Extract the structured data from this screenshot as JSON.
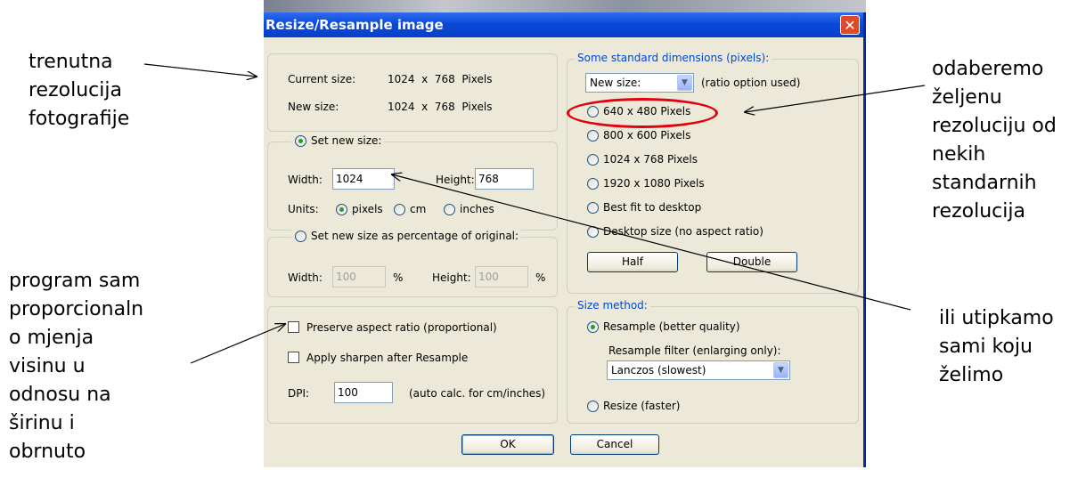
{
  "annotations": {
    "left_top": [
      "trenutna",
      "rezolucija",
      "fotografije"
    ],
    "left_bottom": [
      "program sam",
      "proporcionaln",
      "o mjenja",
      "visinu u",
      "odnosu na",
      "širinu i",
      "obrnuto"
    ],
    "right_top": [
      "odaberemo",
      "željenu",
      "rezoluciju od",
      "nekih",
      "standarnih",
      "rezolucija"
    ],
    "right_bottom": [
      "ili utipkamo",
      "sami koju",
      "želimo"
    ]
  },
  "dialog": {
    "title": "Resize/Resample image",
    "close_glyph": "✕",
    "current_size_label": "Current size:",
    "current_size_value": "1024  x  768  Pixels",
    "new_size_label": "New size:",
    "new_size_value": "1024  x  768  Pixels",
    "set_new_size": {
      "label": "Set new size:",
      "width_label": "Width:",
      "width_value": "1024",
      "height_label": "Height:",
      "height_value": "768",
      "units_label": "Units:",
      "units": [
        "pixels",
        "cm",
        "inches"
      ],
      "selected_unit": "pixels"
    },
    "percentage": {
      "label": "Set new size as percentage of original:",
      "width_label": "Width:",
      "width_value": "100",
      "pct": "%",
      "height_label": "Height:",
      "height_value": "100"
    },
    "preserve_aspect": "Preserve aspect ratio (proportional)",
    "apply_sharpen": "Apply sharpen after Resample",
    "dpi_label": "DPI:",
    "dpi_value": "100",
    "dpi_note": "(auto calc. for cm/inches)",
    "standard_dims": {
      "legend": "Some standard dimensions (pixels):",
      "dropdown_value": "New size:",
      "ratio_note": "(ratio option used)",
      "options": [
        "640 x 480 Pixels",
        "800 x 600 Pixels",
        "1024 x 768 Pixels",
        "1920 x 1080 Pixels",
        "Best fit to desktop",
        "Desktop size (no aspect ratio)"
      ],
      "half_button": "Half",
      "double_button": "Double"
    },
    "size_method": {
      "legend": "Size method:",
      "resample": "Resample (better quality)",
      "filter_label": "Resample filter (enlarging only):",
      "filter_value": "Lanczos (slowest)",
      "resize": "Resize (faster)"
    },
    "ok_button": "OK",
    "cancel_button": "Cancel"
  },
  "colors": {
    "highlight_oval": "#e3000f",
    "title_bar": "#0a4ad8",
    "dialog_bg": "#ece9d8",
    "legend_text": "#0046d5"
  }
}
